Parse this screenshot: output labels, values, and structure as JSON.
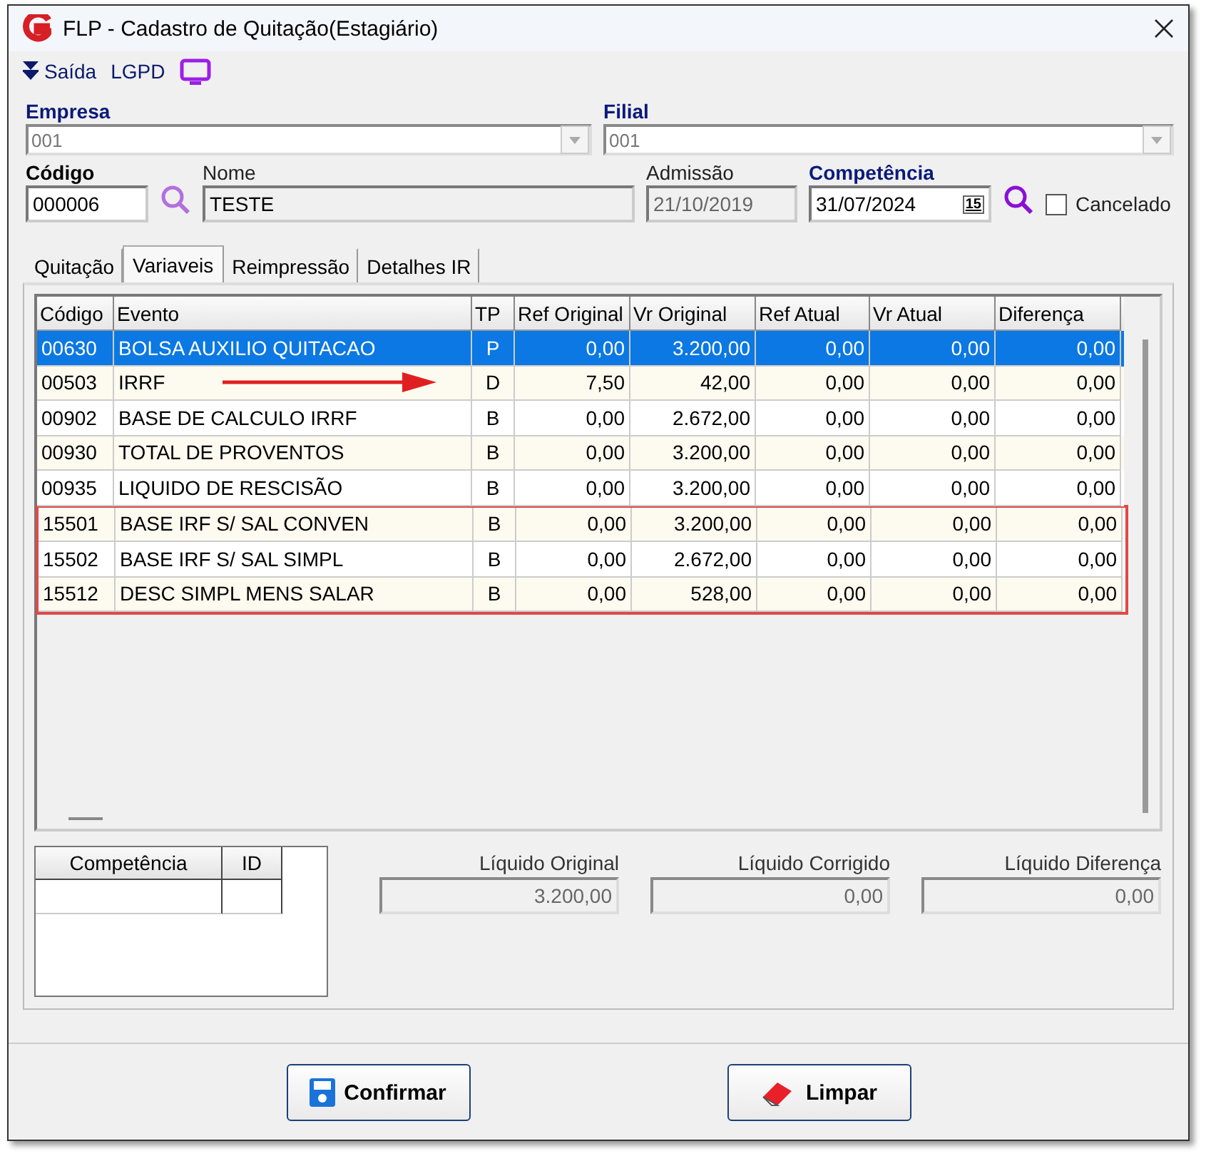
{
  "window": {
    "title": "FLP - Cadastro de Quitação(Estagiário)"
  },
  "toolbar": [
    {
      "kind": "exit",
      "label": "Saída"
    },
    {
      "kind": "text",
      "label": "LGPD"
    },
    {
      "kind": "screen"
    }
  ],
  "empresa": {
    "label": "Empresa",
    "value": "001"
  },
  "filial": {
    "label": "Filial",
    "value": "001"
  },
  "codigo": {
    "label": "Código",
    "value": "000006"
  },
  "nome": {
    "label": "Nome",
    "value": "TESTE"
  },
  "admissao": {
    "label": "Admissão",
    "value": "21/10/2019"
  },
  "competencia": {
    "label": "Competência",
    "value": "31/07/2024",
    "calendar": "15"
  },
  "cancelado": {
    "label": "Cancelado",
    "checked": false
  },
  "tabs": [
    {
      "label": "Quitação",
      "selected": false
    },
    {
      "label": "Variaveis",
      "selected": true
    },
    {
      "label": "Reimpressão",
      "selected": false
    },
    {
      "label": "Detalhes IR",
      "selected": false
    }
  ],
  "table": {
    "columns": [
      "Código",
      "Evento",
      "TP",
      "Ref Original",
      "Vr Original",
      "Ref Atual",
      "Vr Atual",
      "Diferença"
    ],
    "rows": [
      {
        "cells": [
          "00630",
          "BOLSA AUXILIO QUITACAO",
          "P",
          "0,00",
          "3.200,00",
          "0,00",
          "0,00",
          "0,00"
        ],
        "selected": true,
        "highlighted": false,
        "arrow": false
      },
      {
        "cells": [
          "00503",
          "IRRF",
          "D",
          "7,50",
          "42,00",
          "0,00",
          "0,00",
          "0,00"
        ],
        "selected": false,
        "highlighted": false,
        "arrow": true
      },
      {
        "cells": [
          "00902",
          "BASE DE CALCULO IRRF",
          "B",
          "0,00",
          "2.672,00",
          "0,00",
          "0,00",
          "0,00"
        ],
        "selected": false,
        "highlighted": false,
        "arrow": false
      },
      {
        "cells": [
          "00930",
          "TOTAL DE PROVENTOS",
          "B",
          "0,00",
          "3.200,00",
          "0,00",
          "0,00",
          "0,00"
        ],
        "selected": false,
        "highlighted": false,
        "arrow": false
      },
      {
        "cells": [
          "00935",
          "LIQUIDO DE RESCISÃO",
          "B",
          "0,00",
          "3.200,00",
          "0,00",
          "0,00",
          "0,00"
        ],
        "selected": false,
        "highlighted": false,
        "arrow": false
      },
      {
        "cells": [
          "15501",
          "BASE IRF S/ SAL CONVEN",
          "B",
          "0,00",
          "3.200,00",
          "0,00",
          "0,00",
          "0,00"
        ],
        "selected": false,
        "highlighted": true,
        "arrow": false
      },
      {
        "cells": [
          "15502",
          "BASE IRF S/ SAL SIMPL",
          "B",
          "0,00",
          "2.672,00",
          "0,00",
          "0,00",
          "0,00"
        ],
        "selected": false,
        "highlighted": true,
        "arrow": false
      },
      {
        "cells": [
          "15512",
          "DESC SIMPL MENS SALAR",
          "B",
          "0,00",
          "528,00",
          "0,00",
          "0,00",
          "0,00"
        ],
        "selected": false,
        "highlighted": true,
        "arrow": false
      }
    ]
  },
  "history": {
    "columns": [
      "Competência",
      "ID"
    ]
  },
  "totals": [
    {
      "label": "Líquido Original",
      "value": "3.200,00"
    },
    {
      "label": "Líquido Corrigido",
      "value": "0,00"
    },
    {
      "label": "Líquido Diferença",
      "value": "0,00"
    }
  ],
  "buttons": [
    {
      "kind": "save",
      "label": "Confirmar"
    },
    {
      "kind": "clear",
      "label": "Limpar"
    }
  ]
}
